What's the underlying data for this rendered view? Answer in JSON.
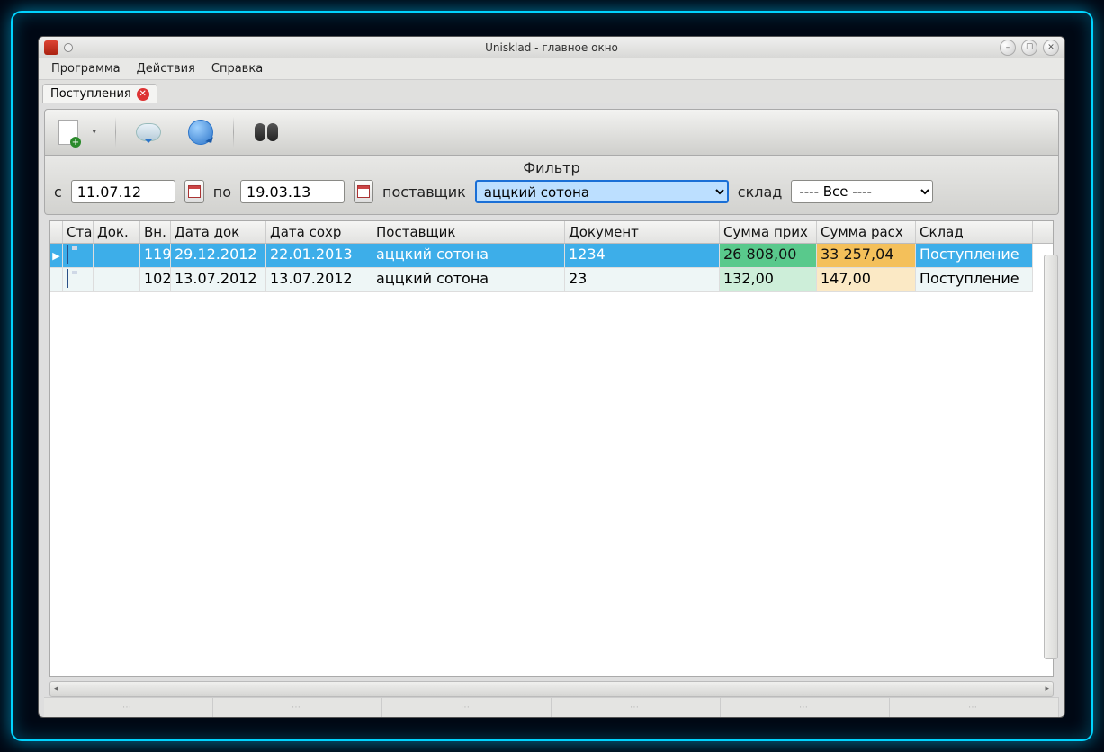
{
  "window": {
    "title": "Unisklad - главное окно"
  },
  "menu": {
    "program": "Программа",
    "actions": "Действия",
    "help": "Справка"
  },
  "tabs": {
    "current": "Поступления"
  },
  "filter": {
    "title": "Фильтр",
    "from_label": "с",
    "from_value": "11.07.12",
    "to_label": "по",
    "to_value": "19.03.13",
    "supplier_label": "поставщик",
    "supplier_value": "аццкий сотона",
    "store_label": "склад",
    "store_value": "---- Все ----"
  },
  "columns": {
    "sta": "Ста",
    "dok": "Док.",
    "vn": "Вн.",
    "datadok": "Дата док",
    "datasohr": "Дата сохр",
    "supplier": "Поставщик",
    "doc": "Документ",
    "sum1": "Сумма прих",
    "sum2": "Сумма расх",
    "sklad": "Склад"
  },
  "rows": [
    {
      "vn": "119",
      "datadok": "29.12.2012",
      "datasohr": "22.01.2013",
      "supplier": "аццкий сотона",
      "doc": "1234",
      "sum1": "26 808,00",
      "sum2": "33 257,04",
      "sklad": "Поступление"
    },
    {
      "vn": "102",
      "datadok": "13.07.2012",
      "datasohr": "13.07.2012",
      "supplier": "аццкий сотона",
      "doc": "23",
      "sum1": "132,00",
      "sum2": "147,00",
      "sklad": "Поступление"
    }
  ]
}
